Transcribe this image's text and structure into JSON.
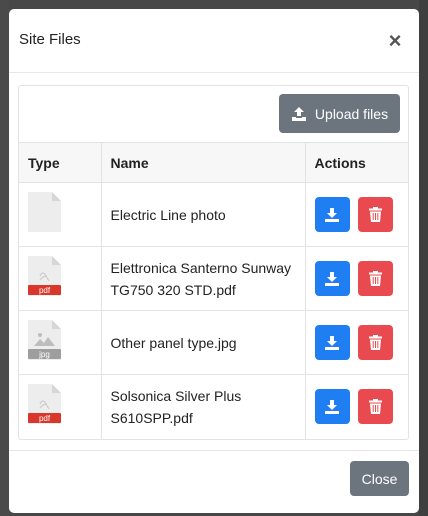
{
  "modal": {
    "title": "Site Files",
    "close_icon": "close-icon",
    "upload_label": "Upload files",
    "footer_close_label": "Close"
  },
  "table": {
    "headers": [
      "Type",
      "Name",
      "Actions"
    ],
    "rows": [
      {
        "type": "generic",
        "badge": "",
        "name_lines": [
          "Electric Line photo"
        ]
      },
      {
        "type": "pdf",
        "badge": "pdf",
        "name_lines": [
          "Elettronica Santerno Sunway",
          "TG750 320 STD.pdf"
        ]
      },
      {
        "type": "jpg",
        "badge": "jpg",
        "name_lines": [
          "Other panel type.jpg"
        ]
      },
      {
        "type": "pdf",
        "badge": "pdf",
        "name_lines": [
          "Solsonica Silver Plus",
          "S610SPP.pdf"
        ]
      }
    ]
  },
  "colors": {
    "download": "#1f7ef2",
    "delete": "#e84a4f",
    "secondary": "#6c757d",
    "pdf_badge": "#d9372b",
    "jpg_badge": "#9e9e9e"
  }
}
